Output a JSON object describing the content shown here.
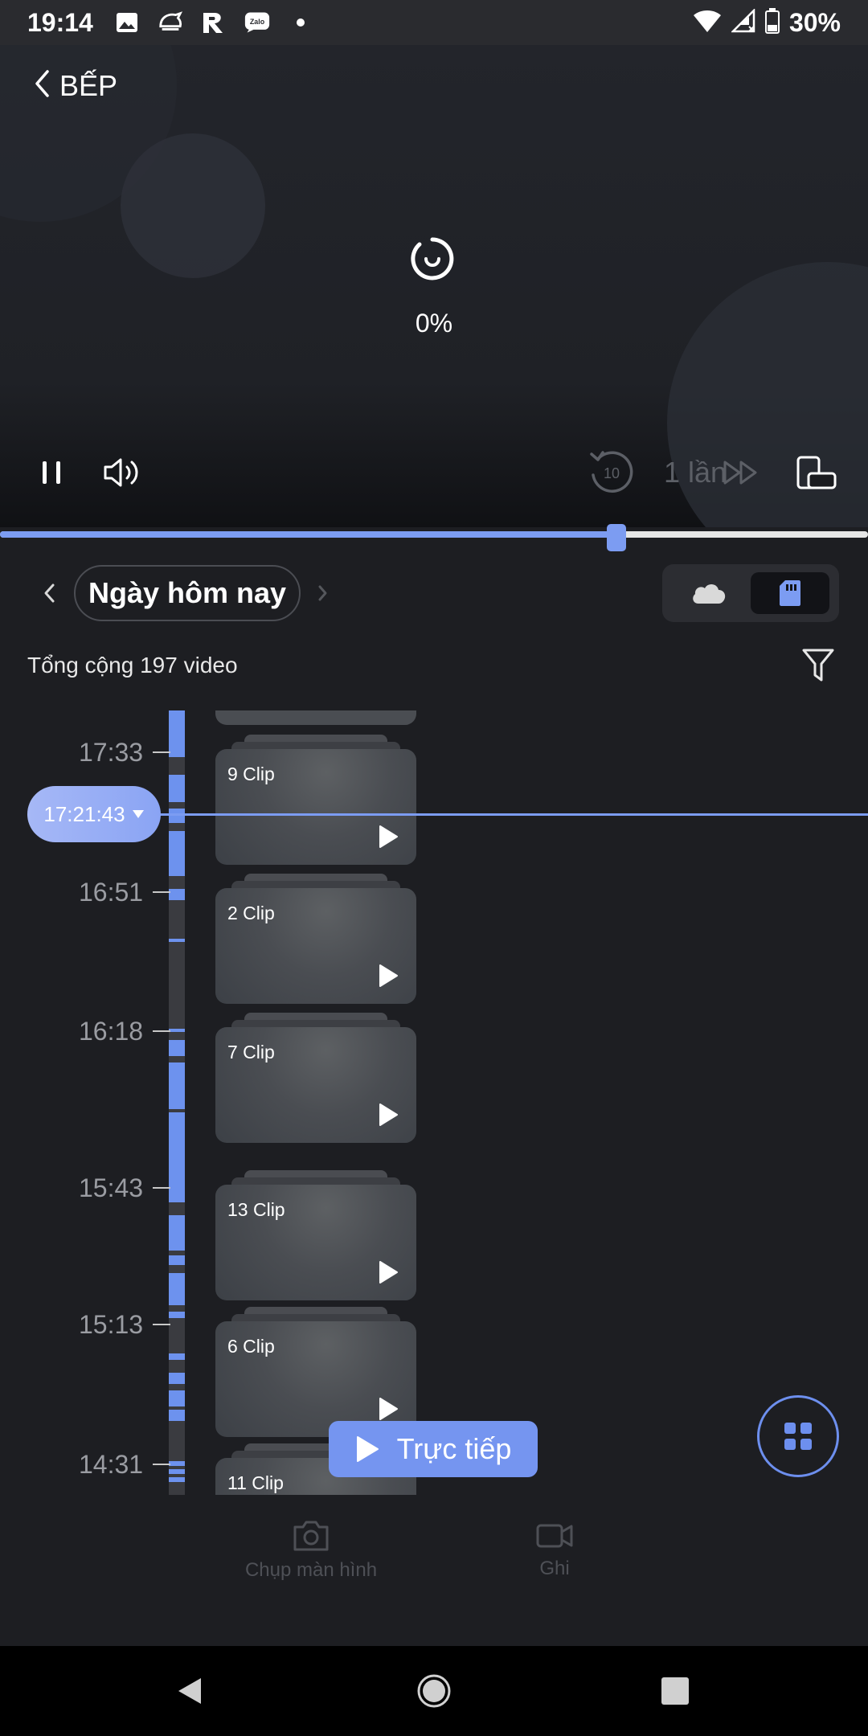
{
  "status_bar": {
    "time": "19:14",
    "battery": "30%",
    "left_icons": [
      "image-icon",
      "helmet-icon",
      "r-app-icon",
      "zalo-icon",
      "dot-icon"
    ],
    "right_icons": [
      "wifi-icon",
      "signal-icon",
      "battery-icon"
    ],
    "zalo_text": "Zalo"
  },
  "header": {
    "title": "BẾP"
  },
  "player": {
    "progress_text": "0%",
    "speed_label": "1 lần",
    "rewind_label": "10",
    "scrub_fraction": 0.71
  },
  "date_nav": {
    "label": "Ngày hôm nay"
  },
  "source_toggle": {
    "options": [
      "cloud",
      "sd-card"
    ],
    "selected": "sd-card"
  },
  "summary": {
    "total_text": "Tổng cộng 197 video"
  },
  "timeline": {
    "time_labels": [
      "17:33",
      "16:51",
      "16:18",
      "15:43",
      "15:13",
      "14:31"
    ],
    "cursor_time": "17:21:43",
    "clips": [
      "9 Clip",
      "2 Clip",
      "7 Clip",
      "13 Clip",
      "6 Clip",
      "11 Clip"
    ]
  },
  "live_button": {
    "label": "Trực tiếp"
  },
  "actions": {
    "screenshot": "Chụp màn hình",
    "record": "Ghi"
  },
  "colors": {
    "accent": "#7c9cf2",
    "background": "#1d1e22",
    "status_bar": "#2a2b2f"
  }
}
